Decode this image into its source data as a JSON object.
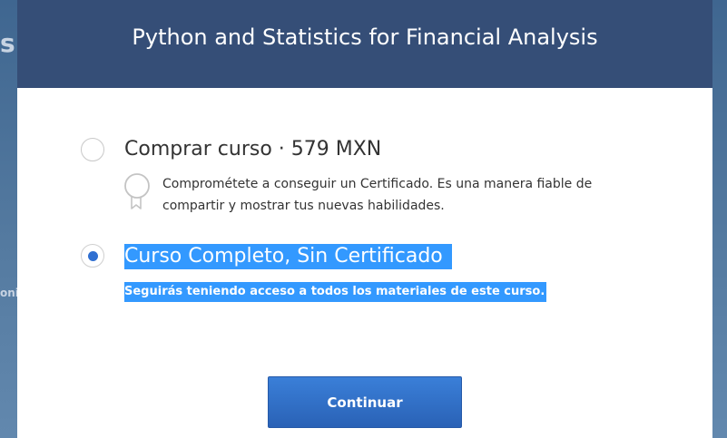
{
  "background": {
    "partial_heading": "s",
    "partial_text": "onil",
    "close_glyph": "×"
  },
  "modal": {
    "title": "Python and Statistics for Financial Analysis",
    "options": [
      {
        "label": "Comprar curso · 579 MXN",
        "description": "Comprométete a conseguir un Certificado. Es una manera fiable de compartir y mostrar tus nuevas habilidades.",
        "selected": false,
        "icon": "certificate-ribbon-icon"
      },
      {
        "label": "Curso Completo, Sin Certificado",
        "description": "Seguirás teniendo acceso a todos los materiales de este curso.",
        "selected": true
      }
    ],
    "continue_label": "Continuar"
  },
  "colors": {
    "header": "#354e77",
    "accent": "#2f6fd1",
    "selection": "#3399ff"
  }
}
